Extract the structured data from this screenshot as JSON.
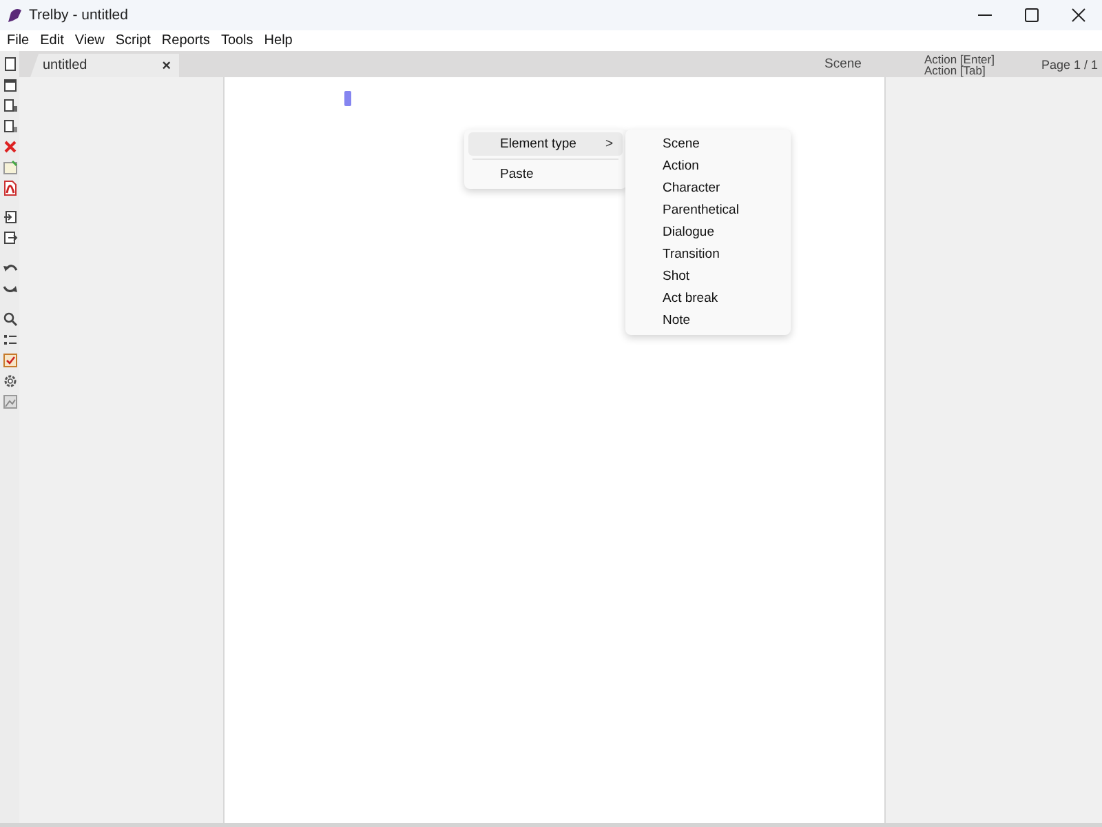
{
  "window": {
    "title": "Trelby - untitled"
  },
  "menu_bar": [
    "File",
    "Edit",
    "View",
    "Script",
    "Reports",
    "Tools",
    "Help"
  ],
  "tabs": [
    {
      "label": "untitled",
      "selected": true,
      "close": "×"
    }
  ],
  "status": {
    "element": "Scene",
    "next_enter": "Action [Enter]",
    "next_tab": "Action [Tab]",
    "page": "Page 1 / 1"
  },
  "context_menu": {
    "items": [
      {
        "label": "Element type",
        "selected": true,
        "submenu_arrow": ">"
      },
      {
        "label": "Paste",
        "selected": false
      }
    ],
    "submenu": [
      "Scene",
      "Action",
      "Character",
      "Parenthetical",
      "Dialogue",
      "Transition",
      "Shot",
      "Act break",
      "Note"
    ]
  }
}
